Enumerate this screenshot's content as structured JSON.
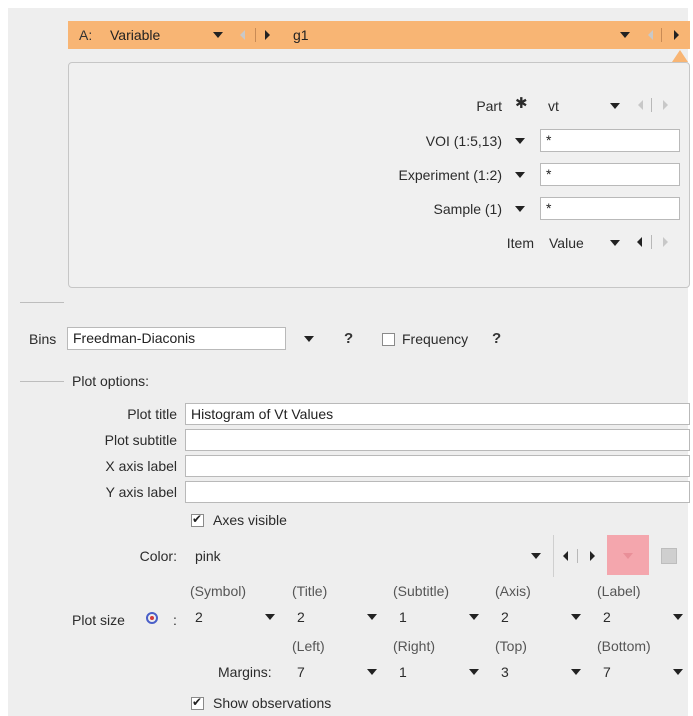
{
  "top_bar": {
    "prefix": "A:",
    "variable": "Variable",
    "group": "g1",
    "bar_color": "#f8b574"
  },
  "selector": {
    "part": {
      "label": "Part",
      "value": "vt"
    },
    "voi": {
      "label": "VOI (1:5,13)",
      "value": "*"
    },
    "experiment": {
      "label": "Experiment (1:2)",
      "value": "*"
    },
    "sample": {
      "label": "Sample (1)",
      "value": "*"
    },
    "item": {
      "label": "Item",
      "value": "Value"
    }
  },
  "bins": {
    "label": "Bins",
    "value": "Freedman-Diaconis",
    "help": "?",
    "frequency_label": "Frequency",
    "frequency_checked": false,
    "frequency_help": "?"
  },
  "plot_options": {
    "section_label": "Plot options:",
    "plot_title": {
      "label": "Plot title",
      "value": "Histogram of Vt Values"
    },
    "plot_subtitle": {
      "label": "Plot subtitle",
      "value": ""
    },
    "x_axis_label": {
      "label": "X axis label",
      "value": ""
    },
    "y_axis_label": {
      "label": "Y axis label",
      "value": ""
    },
    "axes_visible": {
      "label": "Axes visible",
      "checked": true
    },
    "color": {
      "label": "Color:",
      "value": "pink",
      "swatch": "#f4a6ad"
    },
    "plot_size": {
      "label": "Plot size",
      "colon": ":",
      "headers": [
        "(Symbol)",
        "(Title)",
        "(Subtitle)",
        "(Axis)",
        "(Label)"
      ],
      "values": [
        "2",
        "2",
        "1",
        "2",
        "2"
      ]
    },
    "margins": {
      "label": "Margins:",
      "headers": [
        "(Left)",
        "(Right)",
        "(Top)",
        "(Bottom)"
      ],
      "values": [
        "7",
        "1",
        "3",
        "7"
      ]
    },
    "show_observations": {
      "label": "Show observations",
      "checked": true
    }
  }
}
